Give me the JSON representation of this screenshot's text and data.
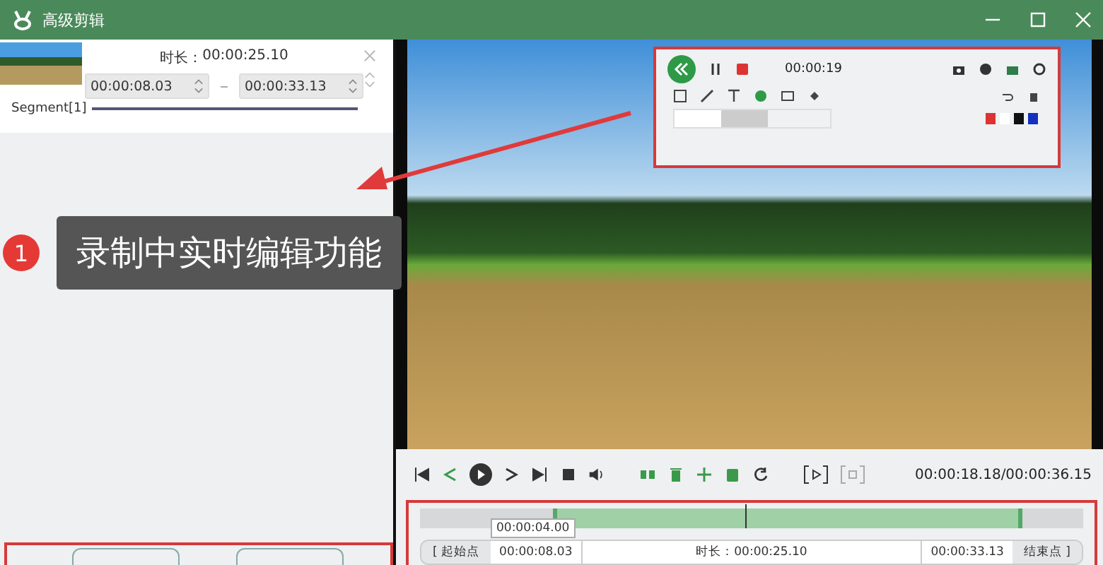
{
  "window": {
    "title": "高级剪辑"
  },
  "segment": {
    "duration_label": "时长：",
    "duration": "00:00:25.10",
    "start": "00:00:08.03",
    "end": "00:00:33.13",
    "name": "Segment[1]"
  },
  "callout": {
    "number": "1",
    "text": "录制中实时编辑功能"
  },
  "recorder_toolbar": {
    "time": "00:00:19"
  },
  "player": {
    "time": "00:00:18.18/00:00:36.15"
  },
  "timeline": {
    "tooltip": "00:00:04.00",
    "start_label": "[ 起始点",
    "start": "00:00:08.03",
    "duration": "时长：00:00:25.10",
    "end": "00:00:33.13",
    "end_label": "结束点 ]"
  }
}
